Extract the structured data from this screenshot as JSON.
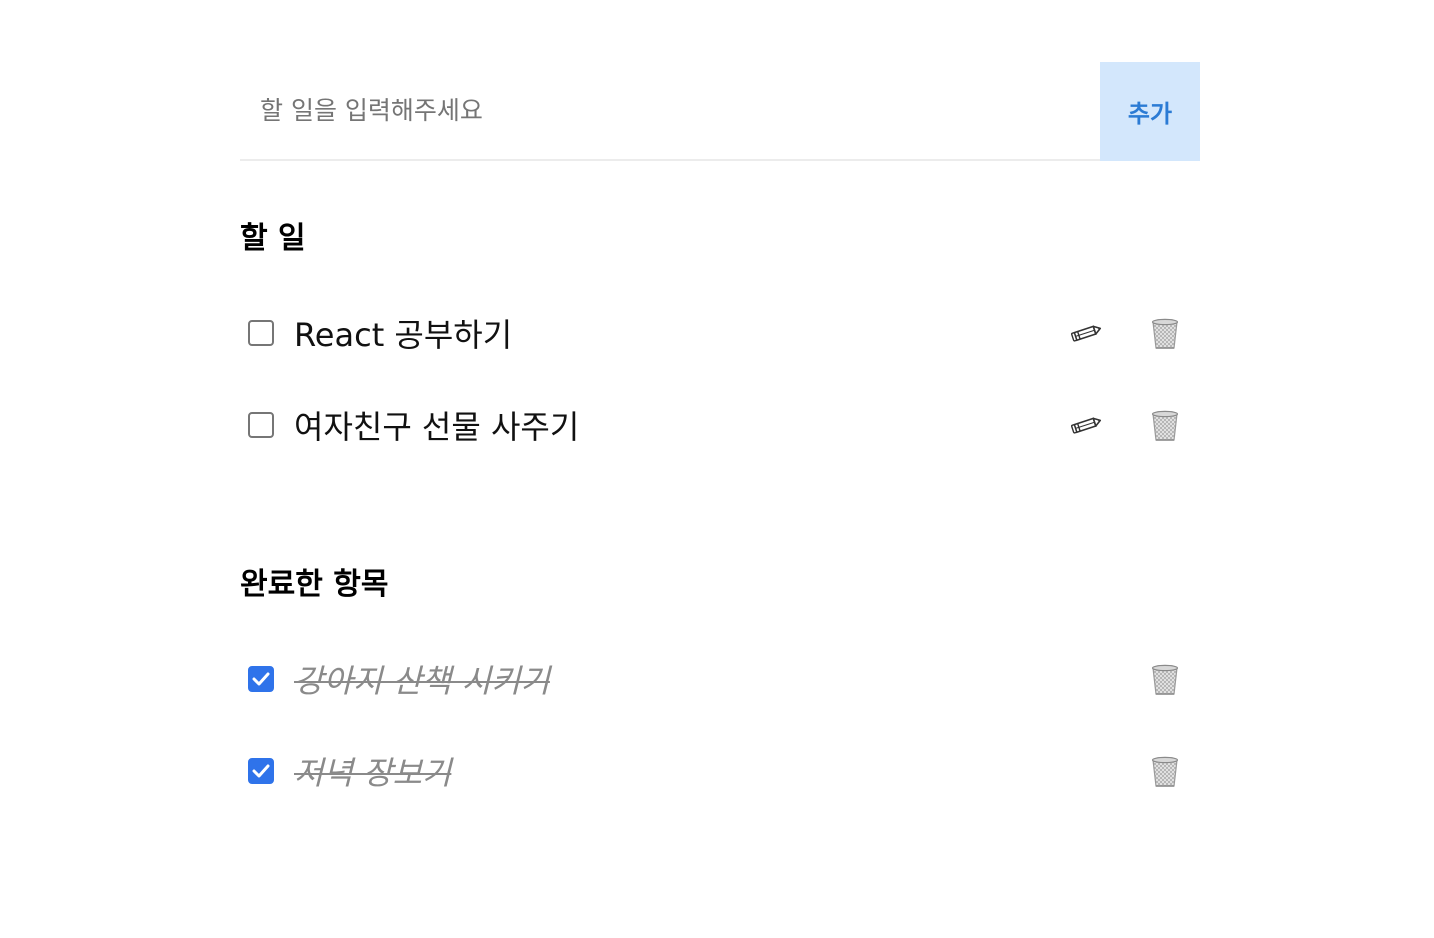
{
  "add_form": {
    "placeholder": "할 일을 입력해주세요",
    "value": "",
    "button_label": "추가",
    "button_bg": "#d3e7fc",
    "button_color": "#2b7bd4"
  },
  "todo_section": {
    "heading": "할 일",
    "items": [
      {
        "text": "React 공부하기",
        "checked": false,
        "edit_icon": "pencil-icon",
        "delete_icon": "trash-icon"
      },
      {
        "text": "여자친구 선물 사주기",
        "checked": false,
        "edit_icon": "pencil-icon",
        "delete_icon": "trash-icon"
      }
    ]
  },
  "done_section": {
    "heading": "완료한 항목",
    "items": [
      {
        "text": "강아지 산책 시키기",
        "checked": true,
        "delete_icon": "trash-icon"
      },
      {
        "text": "저녁 장보기",
        "checked": true,
        "delete_icon": "trash-icon"
      }
    ]
  },
  "colors": {
    "checkbox_checked": "#2f73ea",
    "done_text": "#8a8a8a"
  }
}
